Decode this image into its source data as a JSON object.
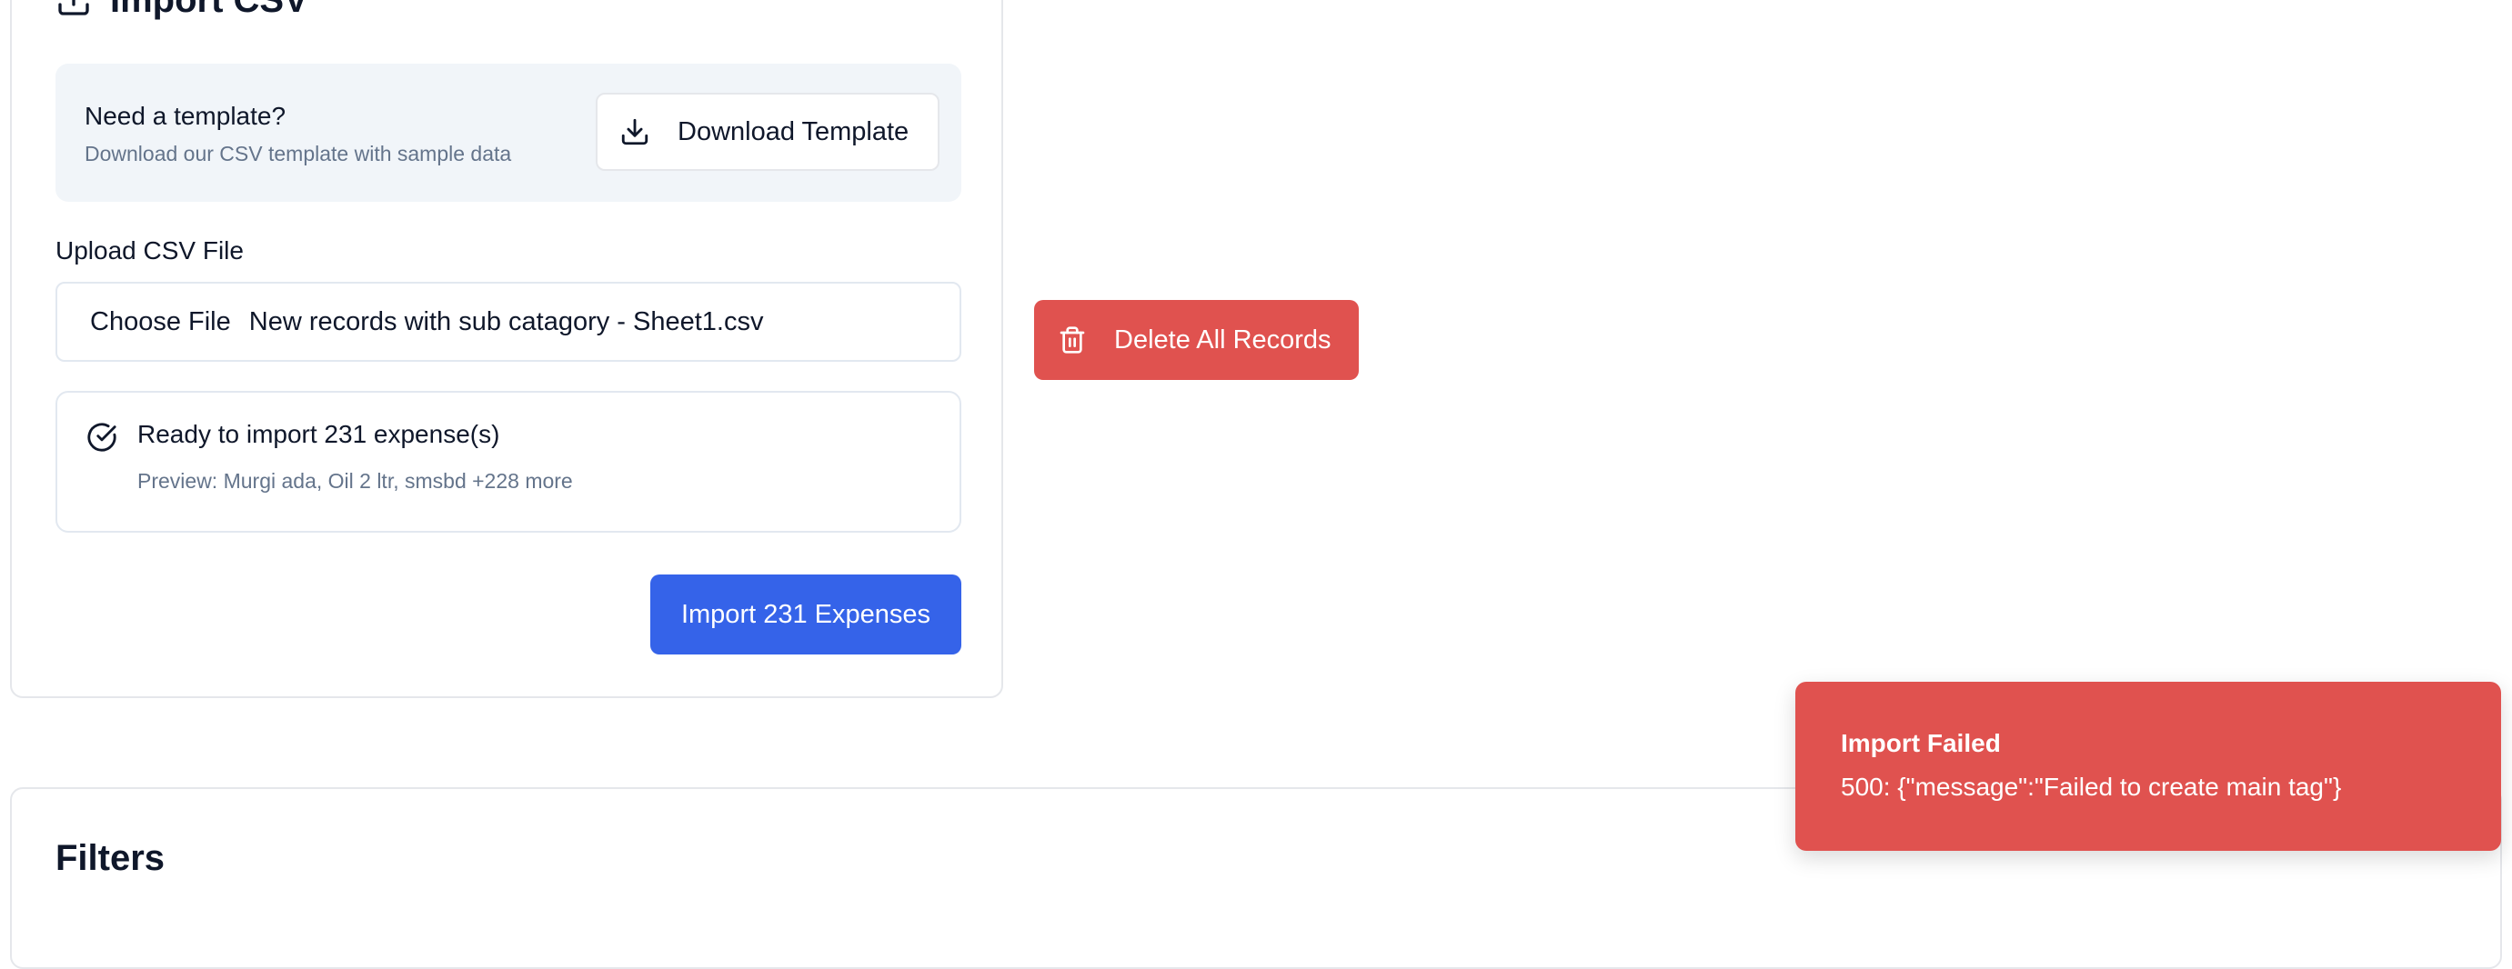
{
  "import_card": {
    "title": "Import CSV",
    "title_icon": "upload-icon",
    "template": {
      "heading": "Need a template?",
      "description": "Download our CSV template with sample data",
      "download_button": {
        "label": "Download Template",
        "icon": "download-icon"
      }
    },
    "upload": {
      "label": "Upload CSV File",
      "choose_file_label": "Choose File",
      "file_name": "New records with sub catagory - Sheet1.csv"
    },
    "ready": {
      "icon": "check-circle-icon",
      "title": "Ready to import 231 expense(s)",
      "preview": "Preview: Murgi ada, Oil 2 ltr, smsbd +228 more"
    },
    "import_button": {
      "label": "Import 231 Expenses"
    }
  },
  "delete_button": {
    "label": "Delete All Records",
    "icon": "trash-icon"
  },
  "filters": {
    "title": "Filters"
  },
  "toast": {
    "title": "Import Failed",
    "message": "500: {\"message\":\"Failed to create main tag\"}"
  },
  "colors": {
    "primary": "#3563e9",
    "danger": "#e0524f",
    "muted_text": "#64748b",
    "panel_bg": "#f1f5f9",
    "border": "#e5e7eb"
  }
}
